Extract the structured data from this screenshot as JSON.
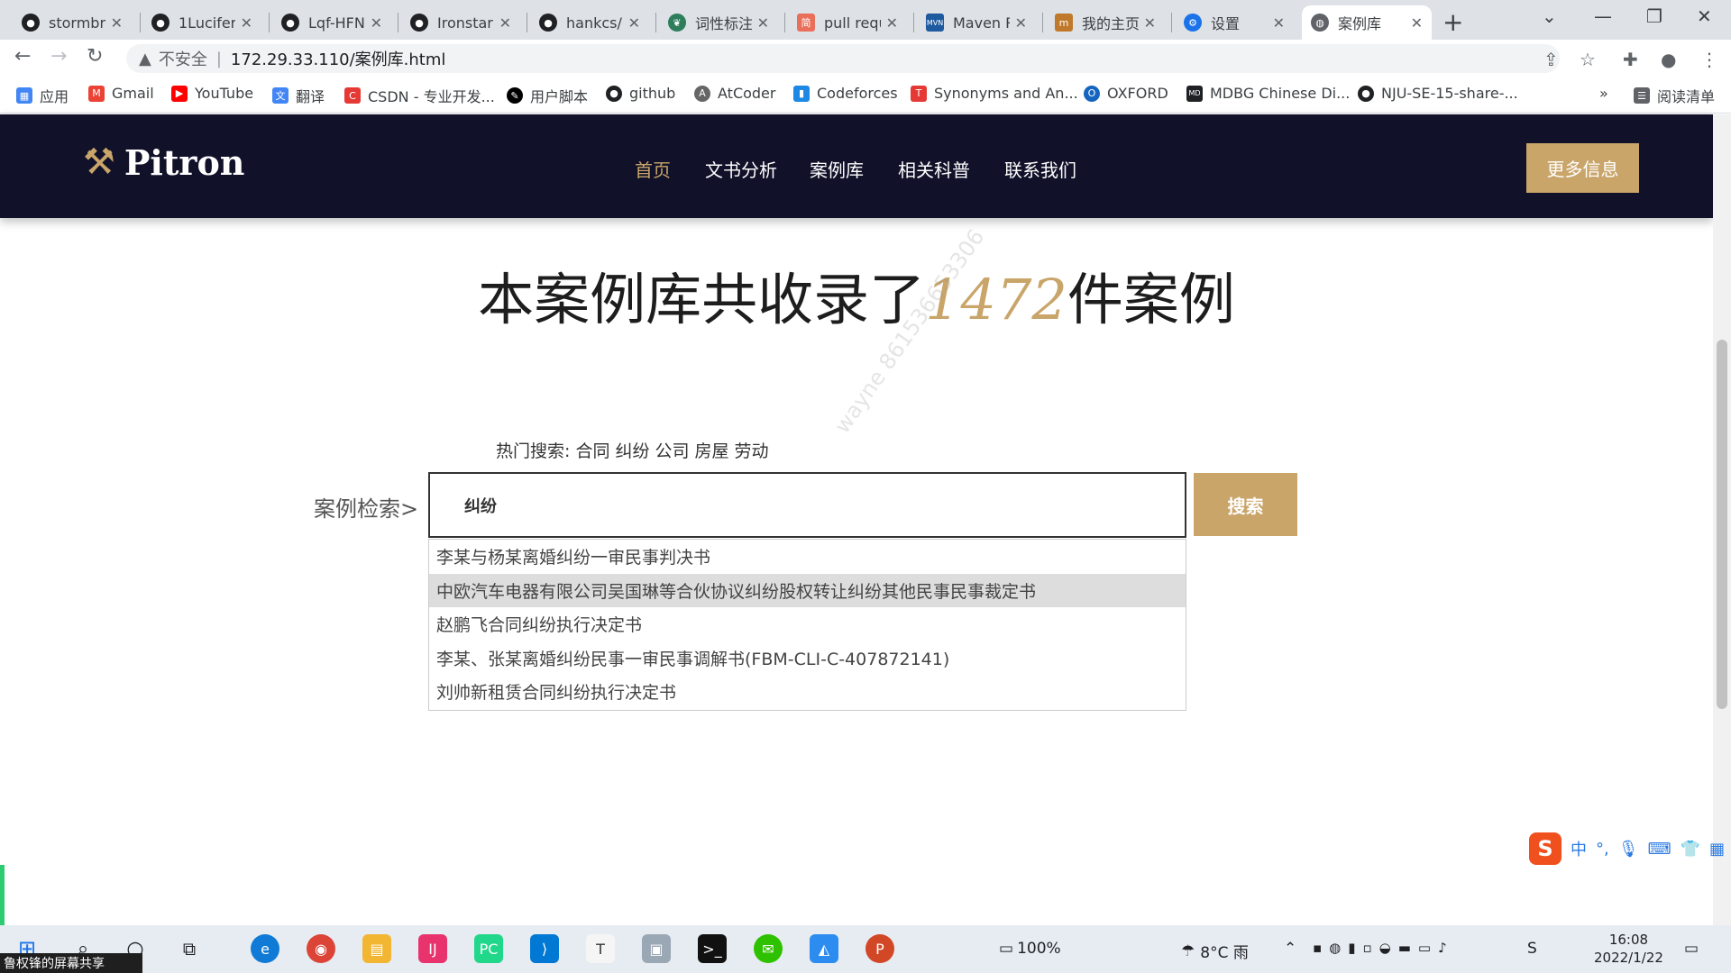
{
  "browser": {
    "tabs": [
      {
        "label": "stormbr",
        "icon": "github-icon",
        "active": false
      },
      {
        "label": "1Lucifer",
        "icon": "github-icon",
        "active": false
      },
      {
        "label": "Lqf-HFN",
        "icon": "github-icon",
        "active": false
      },
      {
        "label": "Ironstar",
        "icon": "github-icon",
        "active": false
      },
      {
        "label": "hankcs/",
        "icon": "github-icon",
        "active": false
      },
      {
        "label": "词性标注",
        "icon": "bird-icon",
        "active": false
      },
      {
        "label": "pull requ",
        "icon": "jianshu-icon",
        "active": false
      },
      {
        "label": "Maven R",
        "icon": "mvn-icon",
        "active": false
      },
      {
        "label": "我的主页",
        "icon": "home-icon",
        "active": false
      },
      {
        "label": "设置",
        "icon": "gear-icon",
        "active": false
      },
      {
        "label": "案例库",
        "icon": "globe-icon",
        "active": true
      }
    ],
    "address": {
      "security_label": "不安全",
      "url": "172.29.33.110/案例库.html"
    },
    "bookmarks": [
      {
        "label": "应用",
        "icon": "apps-grid-icon",
        "color": "#4285f4"
      },
      {
        "label": "Gmail",
        "icon": "gmail-icon",
        "color": "#ea4335"
      },
      {
        "label": "YouTube",
        "icon": "youtube-icon",
        "color": "#ff0000"
      },
      {
        "label": "翻译",
        "icon": "translate-icon",
        "color": "#4285f4"
      },
      {
        "label": "CSDN - 专业开发...",
        "icon": "csdn-icon",
        "color": "#e53935"
      },
      {
        "label": "用户脚本",
        "icon": "userscript-icon",
        "color": "#000000"
      },
      {
        "label": "github",
        "icon": "github-icon",
        "color": "#202124"
      },
      {
        "label": "AtCoder",
        "icon": "atcoder-icon",
        "color": "#666666"
      },
      {
        "label": "Codeforces",
        "icon": "codeforces-icon",
        "color": "#1e88e5"
      },
      {
        "label": "Synonyms and An...",
        "icon": "thesaurus-icon",
        "color": "#e53935"
      },
      {
        "label": "OXFORD",
        "icon": "oxford-icon",
        "color": "#1565c0"
      },
      {
        "label": "MDBG Chinese Di...",
        "icon": "mdbg-icon",
        "color": "#202124"
      },
      {
        "label": "NJU-SE-15-share-...",
        "icon": "github-icon",
        "color": "#202124"
      }
    ],
    "reading_list_label": "阅读清单",
    "more_bookmarks": "»"
  },
  "site": {
    "brand": "Pitron",
    "nav": [
      {
        "label": "首页",
        "current": true
      },
      {
        "label": "文书分析",
        "current": false
      },
      {
        "label": "案例库",
        "current": false
      },
      {
        "label": "相关科普",
        "current": false
      },
      {
        "label": "联系我们",
        "current": false
      }
    ],
    "more_button": "更多信息",
    "accent_color": "#c9a56a",
    "header_color": "#11112a"
  },
  "main": {
    "headline_prefix": "本案例库共收录了",
    "case_count": "1472",
    "headline_suffix": "件案例",
    "hot_search_label": "热门搜索:",
    "hot_terms": [
      "合同",
      "纠纷",
      "公司",
      "房屋",
      "劳动"
    ],
    "search_label": "案例检索>",
    "search_value": "纠纷",
    "search_button": "搜索",
    "suggestions": [
      {
        "text": "李某与杨某离婚纠纷一审民事判决书",
        "highlighted": false
      },
      {
        "text": "中欧汽车电器有限公司吴国琳等合伙协议纠纷股权转让纠纷其他民事民事裁定书",
        "highlighted": true
      },
      {
        "text": "赵鹏飞合同纠纷执行决定书",
        "highlighted": false
      },
      {
        "text": "李某、张某离婚纠纷民事一审民事调解书(FBM-CLI-C-407872141)",
        "highlighted": false
      },
      {
        "text": "刘帅新租赁合同纠纷执行决定书",
        "highlighted": false
      }
    ],
    "watermark": "wayne 861536653306"
  },
  "taskbar": {
    "weather": "8°C 雨",
    "battery": "100%",
    "ime_mode": "中",
    "time": "16:08",
    "date": "2022/1/22",
    "screenshare_label": "鲁权锋的屏幕共享"
  }
}
